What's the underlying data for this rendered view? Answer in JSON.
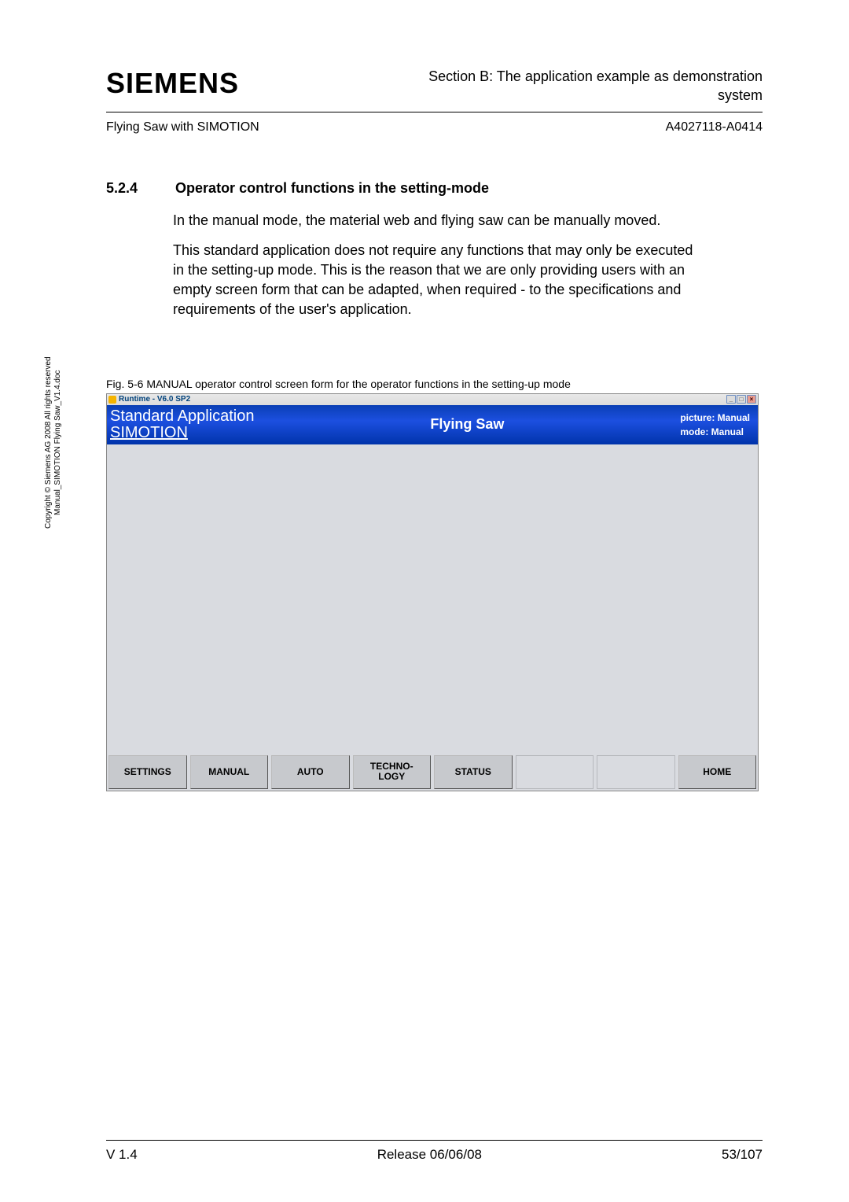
{
  "header": {
    "logo_text": "SIEMENS",
    "section_text_line1": "Section B:  The application example as demonstration",
    "section_text_line2": "system"
  },
  "subheader": {
    "left": "Flying Saw with SIMOTION",
    "right": "A4027118-A0414"
  },
  "section": {
    "number": "5.2.4",
    "title": "Operator control functions in the setting-mode"
  },
  "paragraphs": [
    "In the manual mode, the material web and flying saw can be manually moved.",
    "This standard application does not require any functions that may only be executed in the setting-up mode. This is the reason that we are only providing users with an empty screen form that can be adapted, when required - to the specifications and requirements of the user's application."
  ],
  "figure_caption": "Fig. 5-6 MANUAL operator control screen form for the operator functions in the setting-up mode",
  "hmi": {
    "window_title": "Runtime - V6.0 SP2",
    "header_left_line1": "Standard Application",
    "header_left_line2": "SIMOTION",
    "header_center": "Flying Saw",
    "header_right_line1": "picture: Manual",
    "header_right_line2": "mode: Manual",
    "buttons": [
      {
        "label": "SETTINGS",
        "active": true
      },
      {
        "label": "MANUAL",
        "active": true
      },
      {
        "label": "AUTO",
        "active": true
      },
      {
        "label": "TECHNO-\nLOGY",
        "active": true
      },
      {
        "label": "STATUS",
        "active": true
      },
      {
        "label": "",
        "active": false
      },
      {
        "label": "",
        "active": false
      },
      {
        "label": "HOME",
        "active": true
      }
    ]
  },
  "side_copyright_line1": "Copyright © Siemens AG 2008 All rights reserved",
  "side_copyright_line2": "Manual_SIMOTION Flying Saw_V1.4.doc",
  "footer": {
    "left": "V 1.4",
    "center": "Release 06/06/08",
    "right": "53/107"
  }
}
